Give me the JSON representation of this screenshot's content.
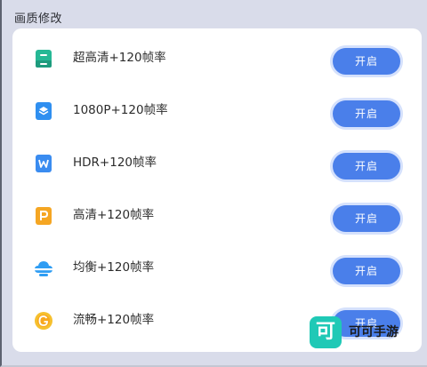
{
  "section": {
    "title": "画质修改"
  },
  "options": [
    {
      "label": "超高清+120帧率",
      "button": "开启",
      "icon": "green-archive-icon",
      "color": "#26b895"
    },
    {
      "label": "1080P+120帧率",
      "button": "开启",
      "icon": "blue-layers-icon",
      "color": "#2f8ff0"
    },
    {
      "label": "HDR+120帧率",
      "button": "开启",
      "icon": "blue-w-doc-icon",
      "color": "#3a8cf0"
    },
    {
      "label": "高清+120帧率",
      "button": "开启",
      "icon": "orange-p-doc-icon",
      "color": "#f5a623"
    },
    {
      "label": "均衡+120帧率",
      "button": "开启",
      "icon": "blue-cloud-icon",
      "color": "#2f9df3"
    },
    {
      "label": "流畅+120帧率",
      "button": "开启",
      "icon": "yellow-g-circle-icon",
      "color": "#f6c02e"
    }
  ],
  "watermark": {
    "badge": "可",
    "text": "可可手游"
  },
  "colors": {
    "button": "#4a7fea",
    "background": "#d9dcea",
    "card": "#ffffff"
  }
}
